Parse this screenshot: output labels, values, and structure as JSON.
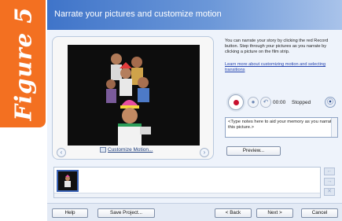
{
  "figure_label": "Figure 5",
  "window": {
    "title": "Narrate your pictures and customize motion"
  },
  "preview": {
    "customize_motion_label": "Customize Motion...",
    "prev_icon": "chevron-left-icon",
    "next_icon": "chevron-right-icon"
  },
  "instructions": {
    "description": "You can narrate your story by clicking the red Record button. Step through your pictures as you narrate by clicking a picture on the film strip.",
    "learn_more_link": "Learn more about customizing motion and selecting transitions"
  },
  "recorder": {
    "record_icon": "record-icon",
    "stop_icon": "stop-icon",
    "undo_icon": "undo-icon",
    "time": "00:00",
    "status": "Stopped",
    "mic_icon": "microphone-icon"
  },
  "notes": {
    "placeholder": "<Type notes here to aid your memory as you narrate this picture.>"
  },
  "preview_button_label": "Preview...",
  "filmstrip": {
    "thumbnails": 1
  },
  "footer": {
    "help_label": "Help",
    "save_project_label": "Save Project...",
    "back_label": "< Back",
    "next_label": "Next >",
    "cancel_label": "Cancel"
  },
  "colors": {
    "figure_tab": "#f37021",
    "header": "#3f74c9",
    "record": "#c8102e"
  }
}
